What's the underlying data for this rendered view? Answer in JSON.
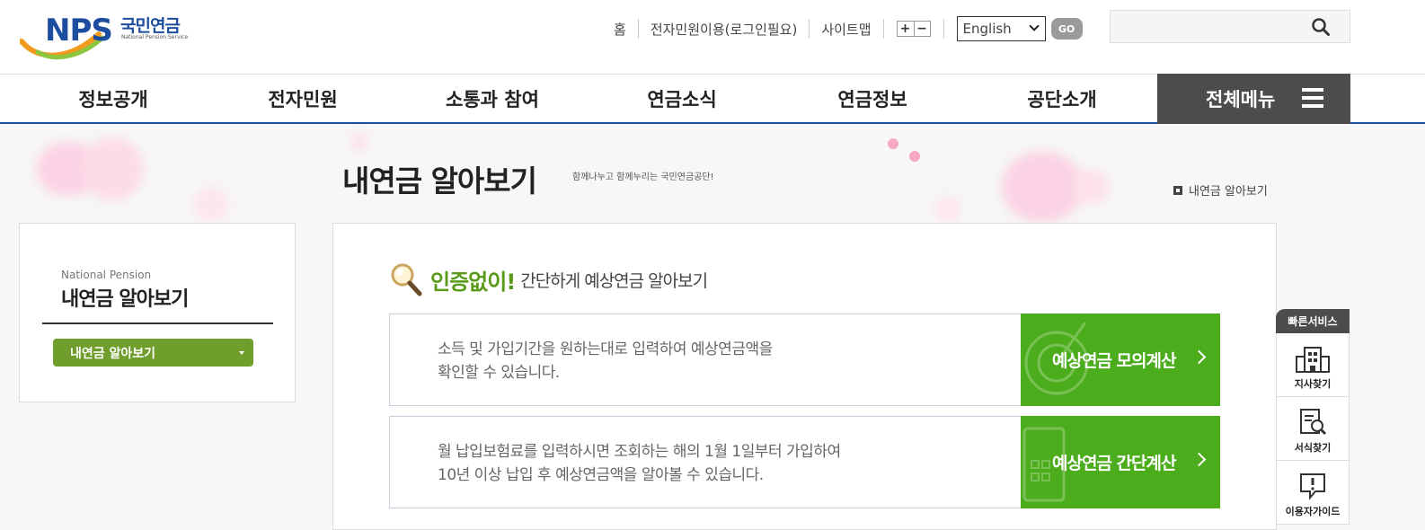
{
  "header": {
    "logo_text": "NPS",
    "logo_korean": "국민연금",
    "logo_english": "National Pension Service",
    "util_links": [
      "홈",
      "전자민원이용(로그인필요)",
      "사이트맵"
    ],
    "zoom_in": "+",
    "zoom_out": "−",
    "language_selected": "English",
    "go_label": "GO",
    "search_placeholder": ""
  },
  "gnb": {
    "items": [
      "정보공개",
      "전자민원",
      "소통과 참여",
      "연금소식",
      "연금정보",
      "공단소개"
    ],
    "all_menu": "전체메뉴"
  },
  "page": {
    "title": "내연금 알아보기",
    "slogan": "함께나누고 함께누리는 국민연금공단!",
    "breadcrumb": "내연금 알아보기"
  },
  "lnb": {
    "english": "National Pension",
    "title": "내연금 알아보기",
    "selected": "내연금 알아보기"
  },
  "content": {
    "headline": "인증없이!",
    "subheadline": "간단하게 예상연금 알아보기",
    "cards": [
      {
        "desc_line1": "소득 및 가입기간을 원하는대로 입력하여 예상연금액을",
        "desc_line2": "확인할 수 있습니다.",
        "button": "예상연금 모의계산"
      },
      {
        "desc_line1": "월 납입보험료를 입력하시면 조회하는 해의 1월 1일부터 가입하여",
        "desc_line2": "10년 이상 납입 후 예상연금액을 알아볼 수 있습니다.",
        "button": "예상연금 간단계산"
      }
    ]
  },
  "quick": {
    "title": "빠른서비스",
    "items": [
      "지사찾기",
      "서식찾기",
      "이용자가이드"
    ]
  },
  "colors": {
    "brand_blue": "#1c4d9e",
    "green": "#4cad1c",
    "dark_gray": "#4e4c4b"
  }
}
